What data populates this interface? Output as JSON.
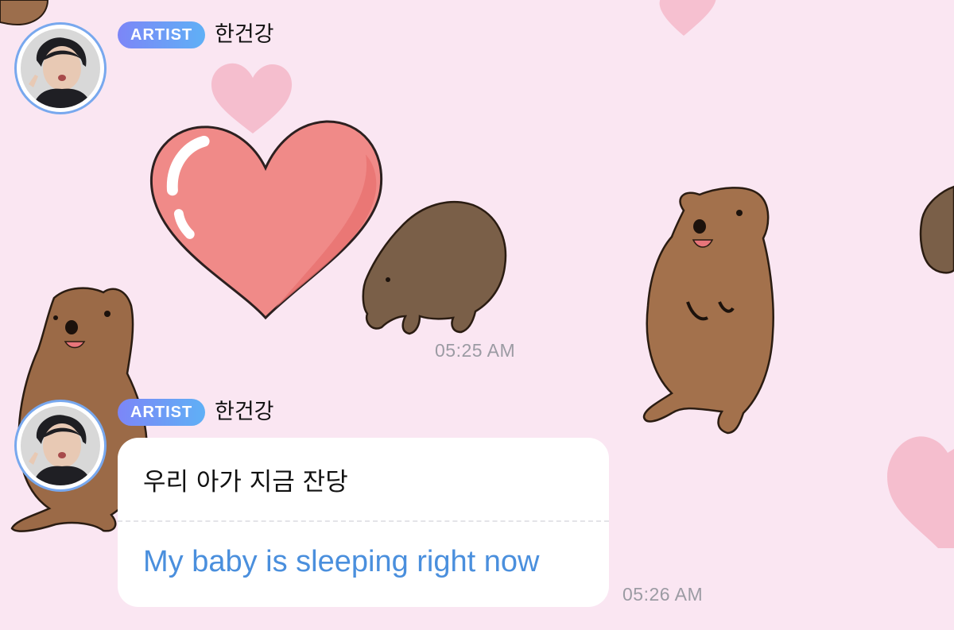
{
  "colors": {
    "background": "#fae6f2",
    "badge_gradient_start": "#7c86f7",
    "badge_gradient_end": "#5fb0f6",
    "avatar_ring": "#78a8ee",
    "translation_text": "#4a8fdd",
    "timestamp_text": "#9b9ba3"
  },
  "messages": [
    {
      "badge": "ARTIST",
      "sender": "한건강",
      "content_type": "sticker",
      "sticker_icon": "heart-and-quokka-sticker",
      "time": "05:25 AM"
    },
    {
      "badge": "ARTIST",
      "sender": "한건강",
      "content_type": "text",
      "original_text": "우리 아가 지금 잔당",
      "translated_text": "My baby is sleeping right now",
      "time": "05:26 AM"
    }
  ]
}
